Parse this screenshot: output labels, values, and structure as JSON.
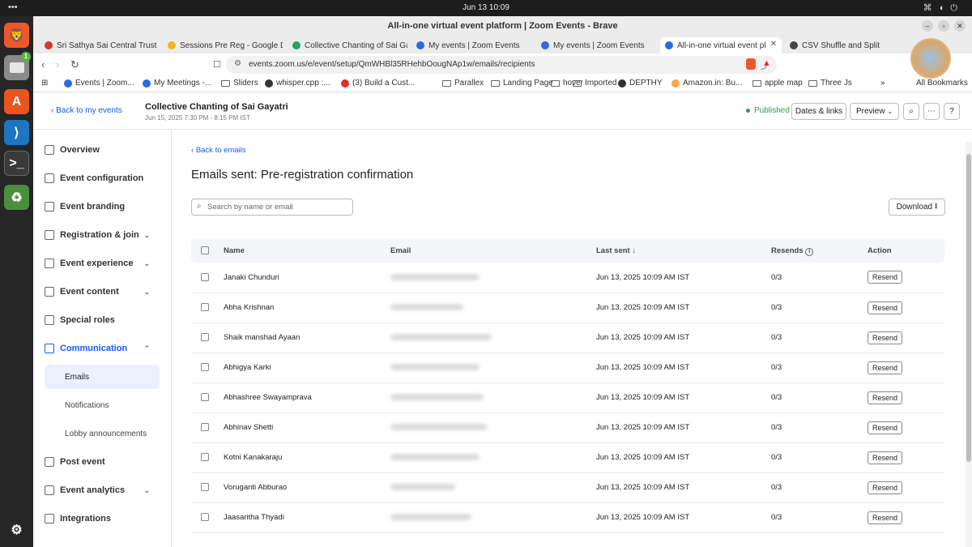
{
  "system": {
    "activities": "•••",
    "clock": "Jun 13  10:09"
  },
  "window": {
    "title": "All-in-one virtual event platform | Zoom Events - Brave"
  },
  "tabs": [
    {
      "label": "Sri Sathya Sai Central Trust M",
      "color": "#d23b2a"
    },
    {
      "label": "Sessions Pre Reg - Google Dr",
      "color": "#f2b61b"
    },
    {
      "label": "Collective Chanting of Sai Ga",
      "color": "#21a464"
    },
    {
      "label": "My events | Zoom Events",
      "color": "#2d6be4"
    },
    {
      "label": "My events | Zoom Events",
      "color": "#2d6be4"
    },
    {
      "label": "All-in-one virtual event pl",
      "color": "#2d6be4"
    },
    {
      "label": "CSV Shuffle and Split",
      "color": "#444444"
    }
  ],
  "nav": {
    "url": "events.zoom.us/e/event/setup/QmWHBl35RHehbOougNAp1w/emails/recipients"
  },
  "bookmarks": [
    {
      "label": "Events | Zoom...",
      "kind": "site",
      "color": "#2d6be4"
    },
    {
      "label": "My Meetings -...",
      "kind": "site",
      "color": "#2d6be4"
    },
    {
      "label": "Sliders",
      "kind": "folder"
    },
    {
      "label": "whisper.cpp :...",
      "kind": "site",
      "color": "#333333"
    },
    {
      "label": "(3) Build a Cust...",
      "kind": "site",
      "color": "#e52d27"
    },
    {
      "label": "Parallex",
      "kind": "folder"
    },
    {
      "label": "Landing Page",
      "kind": "folder"
    },
    {
      "label": "hover",
      "kind": "folder"
    },
    {
      "label": "Imported",
      "kind": "folder"
    },
    {
      "label": "DEPTHY",
      "kind": "site",
      "color": "#333333"
    },
    {
      "label": "Amazon.in: Bu...",
      "kind": "site",
      "color": "#f3a847"
    },
    {
      "label": "apple map",
      "kind": "folder"
    },
    {
      "label": "Three Js",
      "kind": "folder"
    }
  ],
  "bookmarks_more": "»",
  "bookmarks_all": "All Bookmarks",
  "header": {
    "back_label": "Back to my events",
    "event_title": "Collective Chanting of Sai Gayatri",
    "event_date": "Jun 15, 2025 7:30 PM - 8:15 PM IST",
    "status": "Published",
    "dates_links": "Dates & links",
    "preview": "Preview"
  },
  "sidebar": {
    "items": [
      {
        "label": "Overview",
        "has_chevron": false
      },
      {
        "label": "Event configuration",
        "has_chevron": false
      },
      {
        "label": "Event branding",
        "has_chevron": false
      },
      {
        "label": "Registration & join",
        "has_chevron": true
      },
      {
        "label": "Event experience",
        "has_chevron": true
      },
      {
        "label": "Event content",
        "has_chevron": true
      },
      {
        "label": "Special roles",
        "has_chevron": false
      },
      {
        "label": "Communication",
        "has_chevron": true,
        "expanded": true
      }
    ],
    "sub_items": [
      "Emails",
      "Notifications",
      "Lobby announcements"
    ],
    "items_after": [
      "Post event",
      "Event analytics",
      "Integrations"
    ]
  },
  "main": {
    "back_label": "Back to emails",
    "title": "Emails sent: Pre-registration confirmation",
    "search_placeholder": "Search by name or email",
    "download_label": "Download",
    "columns": {
      "name": "Name",
      "email": "Email",
      "last_sent": "Last sent",
      "resends": "Resends",
      "action": "Action"
    },
    "rows": [
      {
        "name": "Janaki Chunduri",
        "last_sent": "Jun 13, 2025 10:09 AM IST",
        "resends": "0/3",
        "action": "Resend"
      },
      {
        "name": "Abha Krishnan",
        "last_sent": "Jun 13, 2025 10:09 AM IST",
        "resends": "0/3",
        "action": "Resend"
      },
      {
        "name": "Shaik manshad Ayaan",
        "last_sent": "Jun 13, 2025 10:09 AM IST",
        "resends": "0/3",
        "action": "Resend"
      },
      {
        "name": "Abhigya Karki",
        "last_sent": "Jun 13, 2025 10:09 AM IST",
        "resends": "0/3",
        "action": "Resend"
      },
      {
        "name": "Abhashree Swayamprava",
        "last_sent": "Jun 13, 2025 10:09 AM IST",
        "resends": "0/3",
        "action": "Resend"
      },
      {
        "name": "Abhinav Shetti",
        "last_sent": "Jun 13, 2025 10:09 AM IST",
        "resends": "0/3",
        "action": "Resend"
      },
      {
        "name": "Kotni Kanakaraju",
        "last_sent": "Jun 13, 2025 10:09 AM IST",
        "resends": "0/3",
        "action": "Resend"
      },
      {
        "name": "Voruganti Abburao",
        "last_sent": "Jun 13, 2025 10:09 AM IST",
        "resends": "0/3",
        "action": "Resend"
      },
      {
        "name": "Jaasaritha Thyadi",
        "last_sent": "Jun 13, 2025 10:09 AM IST",
        "resends": "0/3",
        "action": "Resend"
      }
    ]
  },
  "colors": {
    "accent": "#0b5cff",
    "published": "#2e9d4e",
    "selected_bg": "#eaf1fd"
  }
}
